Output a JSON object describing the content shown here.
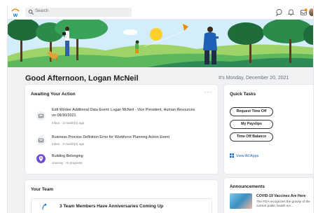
{
  "topbar": {
    "search_placeholder": "Search",
    "icons": [
      "workday-logo-icon",
      "search-icon",
      "chat-icon",
      "bell-icon",
      "inbox-icon",
      "user-avatar"
    ],
    "inbox_badge": "5"
  },
  "greeting": "Good Afternoon, Logan McNeil",
  "date_text": "It's Monday, December 20, 2021",
  "awaiting": {
    "title": "Awaiting Your Action",
    "more": "···",
    "items": [
      {
        "title": "Edit Worker Additional Data Event: Logan McNeil - Vice President, Human Resources on 08/30/2021",
        "subtitle": "Inbox · 3 month(s) ago",
        "icon": "inbox-task-icon"
      },
      {
        "title": "Business Process Definition Error for Workforce Planning Action Event",
        "subtitle": "Inbox · 3 month(s) ago",
        "icon": "inbox-task-icon"
      },
      {
        "title": "Building Belonging",
        "subtitle": "Journey · In progress",
        "icon": "journey-pin-icon"
      }
    ]
  },
  "quick_tasks": {
    "title": "Quick Tasks",
    "buttons": [
      "Request Time Off",
      "My Payslips",
      "Time Off Balance"
    ],
    "view_all": "View All Apps"
  },
  "your_team": {
    "title": "Your Team",
    "item": "3 Team Members Have Anniversaries Coming Up"
  },
  "announcements": {
    "title": "Announcements",
    "item_title": "COVID-19 Vaccines Are Here",
    "item_body": "The FDA recognizes the gravity of the current public health em..."
  },
  "colors": {
    "accent": "#f38b00",
    "brand_blue": "#0875e1",
    "link": "#1565c0"
  }
}
